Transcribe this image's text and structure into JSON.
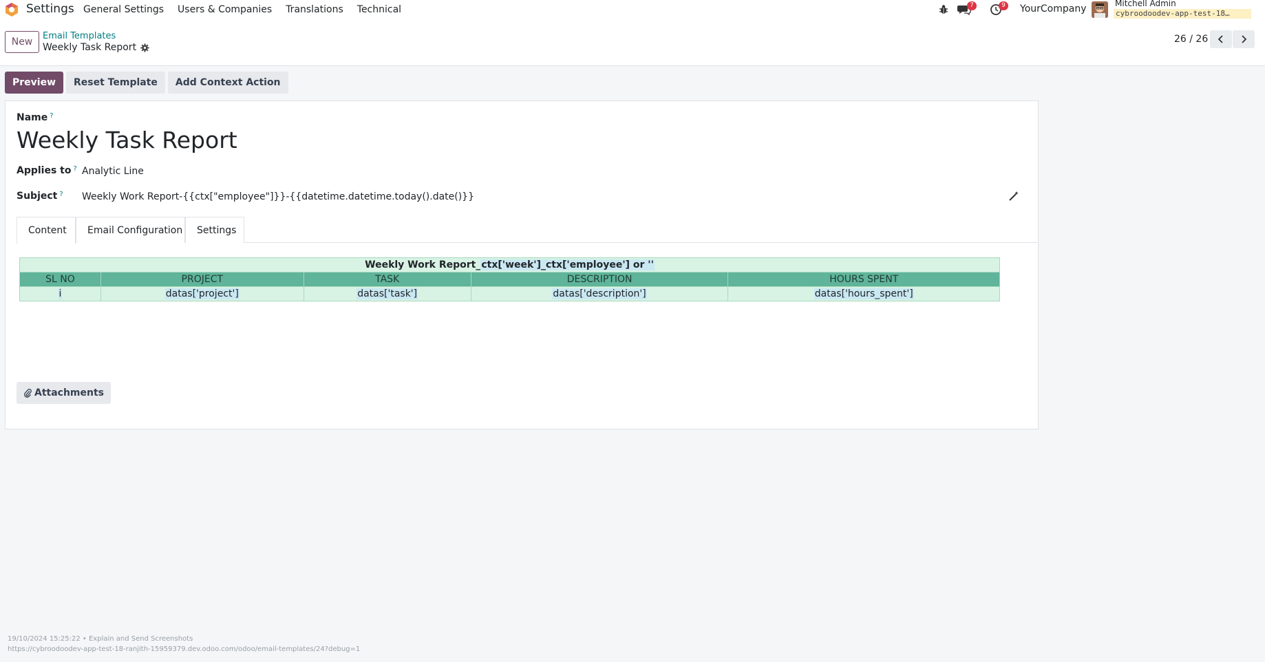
{
  "navbar": {
    "app_name": "Settings",
    "menu": [
      "General Settings",
      "Users & Companies",
      "Translations",
      "Technical"
    ],
    "messages_count": "7",
    "activities_count": "9",
    "company": "YourCompany",
    "user_name": "Mitchell Admin",
    "database": "cybroodoodev-app-test-18…"
  },
  "control_panel": {
    "new_label": "New",
    "breadcrumb_parent": "Email Templates",
    "breadcrumb_current": "Weekly Task Report",
    "pager": "26 / 26"
  },
  "actions": {
    "preview": "Preview",
    "reset_template": "Reset Template",
    "add_context_action": "Add Context Action"
  },
  "form": {
    "name_label": "Name",
    "name_value": "Weekly Task Report",
    "applies_label": "Applies to",
    "applies_value": "Analytic Line",
    "subject_label": "Subject",
    "subject_value": "Weekly Work Report-{{ctx[\"employee\"]}}-{{datetime.datetime.today().date()}}",
    "help_mark": "?"
  },
  "tabs": [
    "Content",
    "Email Configuration",
    "Settings"
  ],
  "report": {
    "title_prefix": "Weekly Work Report_",
    "title_expr": "ctx['week']_ctx['employee'] or ''",
    "headers": [
      "SL NO",
      "PROJECT",
      "TASK",
      "DESCRIPTION",
      "HOURS SPENT"
    ],
    "row": [
      "i",
      "datas['project']",
      "datas['task']",
      "datas['description']",
      "datas['hours_spent']"
    ]
  },
  "attachments_label": "Attachments",
  "footer": {
    "timestamp": "19/10/2024 15:25:22 • Explain and Send Screenshots",
    "url": "https://cybroodoodev-app-test-18-ranjith-15959379.dev.odoo.com/odoo/email-templates/24?debug=1"
  },
  "colors": {
    "brand": "#714b67",
    "link": "#017e84",
    "table_light": "#d8f3e4",
    "table_header": "#5fb49a"
  }
}
